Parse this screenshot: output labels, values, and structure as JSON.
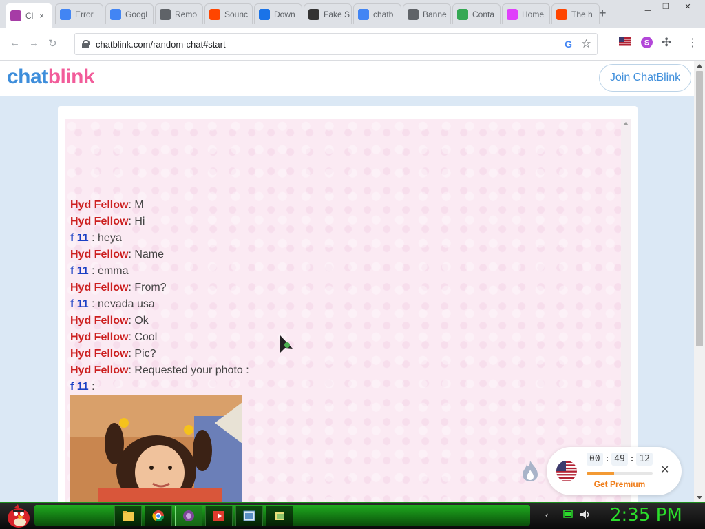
{
  "browser": {
    "tabs": [
      {
        "title": "Cl",
        "icon": "chatblink-icon",
        "color": "#a63ca6",
        "active": true
      },
      {
        "title": "Error",
        "icon": "google-icon",
        "color": "#4285f4"
      },
      {
        "title": "Googl",
        "icon": "google-icon",
        "color": "#4285f4"
      },
      {
        "title": "Remo",
        "icon": "globe-icon",
        "color": "#5f6368"
      },
      {
        "title": "Sounc",
        "icon": "reddit-icon",
        "color": "#ff4500"
      },
      {
        "title": "Down",
        "icon": "download-icon",
        "color": "#1a73e8"
      },
      {
        "title": "Fake S",
        "icon": "person-icon",
        "color": "#333333"
      },
      {
        "title": "chatb",
        "icon": "google-icon",
        "color": "#4285f4"
      },
      {
        "title": "Banne",
        "icon": "globe-icon",
        "color": "#5f6368"
      },
      {
        "title": "Conta",
        "icon": "play-icon",
        "color": "#34a853"
      },
      {
        "title": "Home",
        "icon": "heart-icon",
        "color": "#e040fb"
      },
      {
        "title": "The h",
        "icon": "reddit-icon",
        "color": "#ff4500"
      }
    ],
    "active_tab_close": "×",
    "new_tab": "+",
    "url": "chatblink.com/random-chat#start"
  },
  "site": {
    "logo_chat": "chat",
    "logo_blink": "blink",
    "join_button": "Join ChatBlink"
  },
  "chat": {
    "messages": [
      {
        "sender": "Hyd Fellow",
        "role": "stranger",
        "sep": ": ",
        "text": "M"
      },
      {
        "sender": "Hyd Fellow",
        "role": "stranger",
        "sep": ": ",
        "text": "Hi"
      },
      {
        "sender": "f 11",
        "role": "you",
        "sep": " : ",
        "text": "heya"
      },
      {
        "sender": "Hyd Fellow",
        "role": "stranger",
        "sep": ": ",
        "text": "Name"
      },
      {
        "sender": "f 11",
        "role": "you",
        "sep": " : ",
        "text": "emma"
      },
      {
        "sender": "Hyd Fellow",
        "role": "stranger",
        "sep": ": ",
        "text": "From?"
      },
      {
        "sender": "f 11",
        "role": "you",
        "sep": " : ",
        "text": "nevada usa"
      },
      {
        "sender": "Hyd Fellow",
        "role": "stranger",
        "sep": ": ",
        "text": "Ok"
      },
      {
        "sender": "Hyd Fellow",
        "role": "stranger",
        "sep": ": ",
        "text": "Cool"
      },
      {
        "sender": "Hyd Fellow",
        "role": "stranger",
        "sep": ": ",
        "text": "Pic?"
      },
      {
        "sender": "Hyd Fellow",
        "role": "stranger",
        "sep": ": ",
        "text": "Requested your photo :"
      },
      {
        "sender": "f 11",
        "role": "you",
        "sep": " :",
        "text": ""
      }
    ],
    "colors": {
      "stranger": "#cc1f1f",
      "you": "#1a3fc4"
    }
  },
  "timer": {
    "hours": "00",
    "minutes": "49",
    "seconds": "12",
    "progress": 0.42,
    "premium_label": "Get Premium",
    "close": "×"
  },
  "taskbar": {
    "clock": "2:35 PM",
    "apps": [
      "folder-icon",
      "chrome-icon",
      "tor-icon",
      "media-icon",
      "screen-icon",
      "files-icon"
    ]
  }
}
